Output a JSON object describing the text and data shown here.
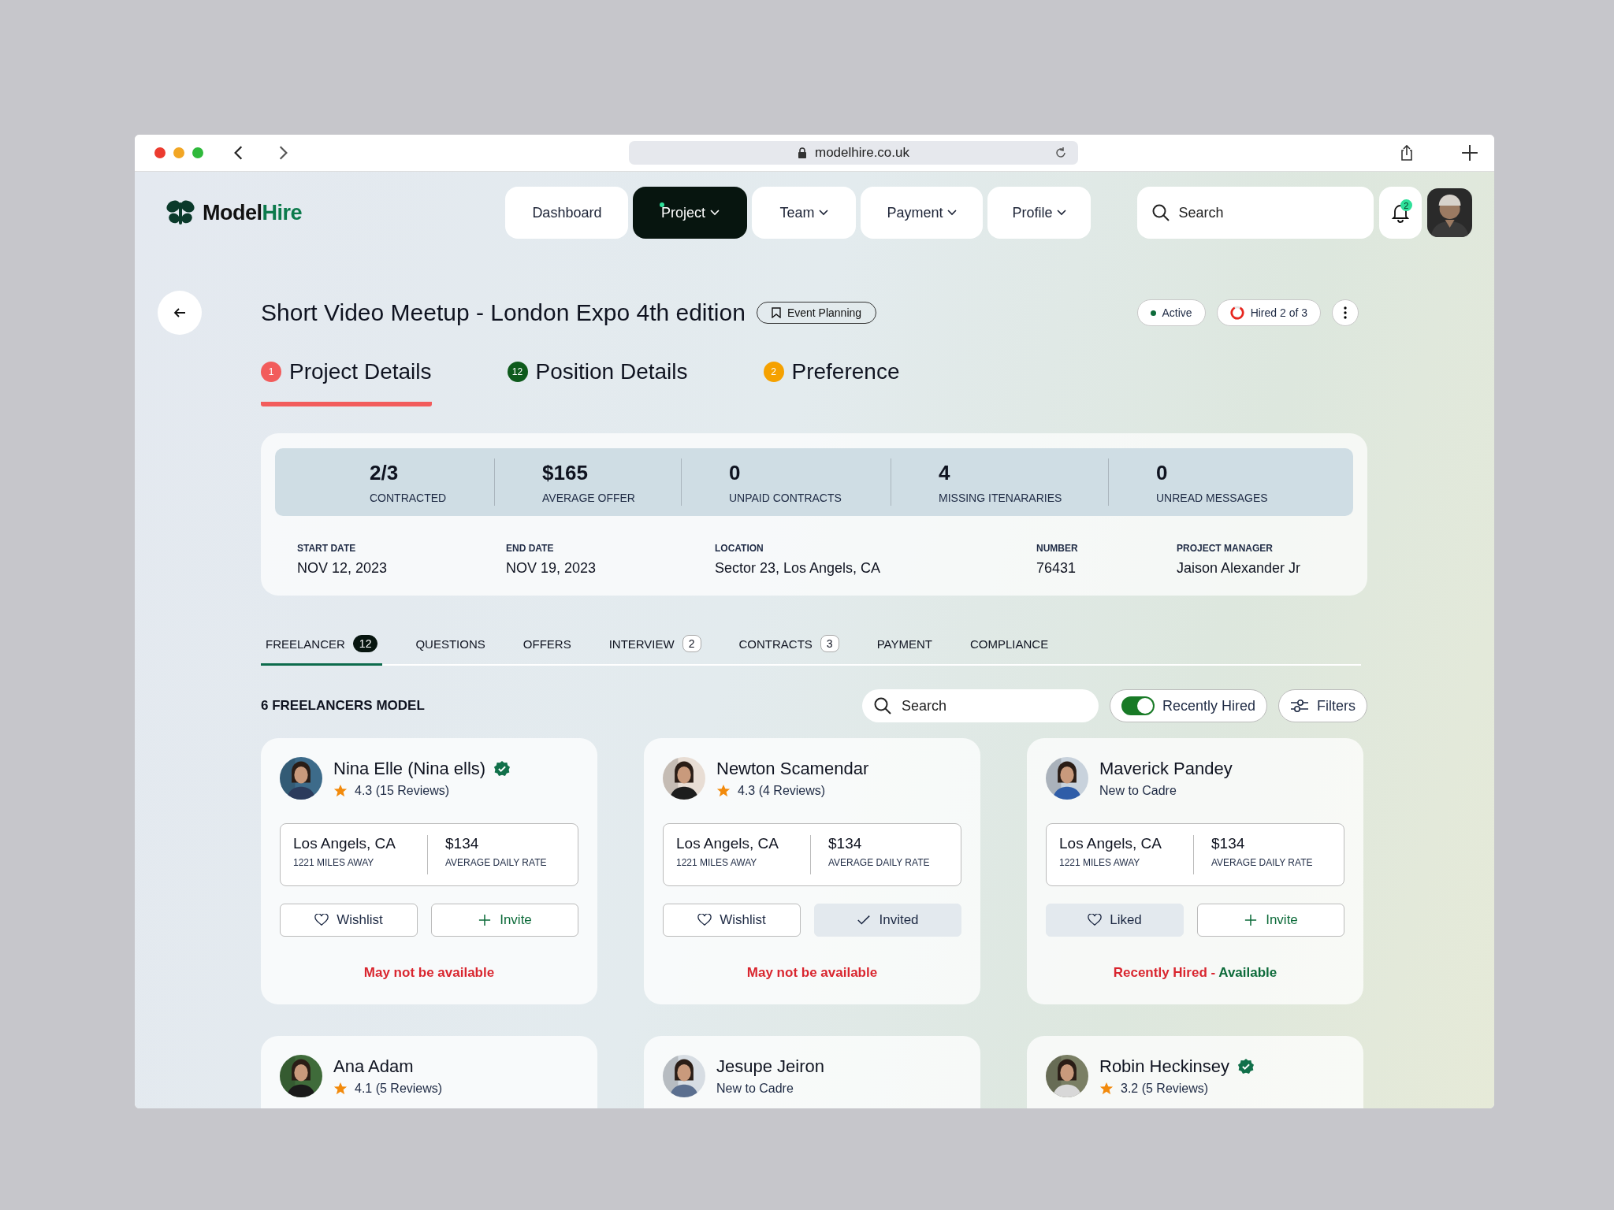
{
  "browser": {
    "url": "modelhire.co.uk"
  },
  "nav": {
    "brand": [
      "Model",
      "Hire"
    ],
    "items": [
      {
        "label": "Dashboard",
        "selected": false,
        "caret": false
      },
      {
        "label": "Project",
        "selected": true,
        "caret": true
      },
      {
        "label": "Team",
        "selected": false,
        "caret": true
      },
      {
        "label": "Payment",
        "selected": false,
        "caret": true
      },
      {
        "label": "Profile",
        "selected": false,
        "caret": true
      }
    ],
    "search": {
      "placeholder": "Search"
    },
    "notifications": "2"
  },
  "project": {
    "title": "Short Video Meetup - London Expo 4th edition",
    "tag": "Event Planning",
    "status": "Active",
    "hired": {
      "label": "Hired 2 of 3"
    }
  },
  "steps": [
    {
      "number": "1",
      "label": "Project Details",
      "color": "#f25c5c",
      "selected": true
    },
    {
      "number": "12",
      "label": "Position Details",
      "color": "#0e5a1c",
      "selected": false
    },
    {
      "number": "2",
      "label": "Preference",
      "color": "#f5a100",
      "selected": false
    }
  ],
  "stats": [
    {
      "value": "2/3",
      "label": "CONTRACTED"
    },
    {
      "value": "$165",
      "label": "AVERAGE OFFER"
    },
    {
      "value": "0",
      "label": "UNPAID CONTRACTS"
    },
    {
      "value": "4",
      "label": "MISSING ITENARARIES"
    },
    {
      "value": "0",
      "label": "UNREAD MESSAGES"
    }
  ],
  "details": [
    {
      "label": "START DATE",
      "value": "NOV 12, 2023"
    },
    {
      "label": "END DATE",
      "value": "NOV 19, 2023"
    },
    {
      "label": "LOCATION",
      "value": "Sector 23,  Los Angels, CA"
    },
    {
      "label": "NUMBER",
      "value": "76431"
    },
    {
      "label": "PROJECT MANAGER",
      "value": "Jaison Alexander Jr"
    }
  ],
  "tabs": [
    {
      "label": "FREELANCER",
      "count": "12",
      "selected": true
    },
    {
      "label": "QUESTIONS",
      "selected": false
    },
    {
      "label": "OFFERS",
      "selected": false
    },
    {
      "label": "INTERVIEW",
      "count": "2",
      "selected": false
    },
    {
      "label": "CONTRACTS",
      "count": "3",
      "selected": false
    },
    {
      "label": "PAYMENT",
      "selected": false
    },
    {
      "label": "COMPLIANCE",
      "selected": false
    }
  ],
  "list": {
    "title": "6 FREELANCERS MODEL",
    "search": {
      "placeholder": "Search"
    },
    "toggle": {
      "label": "Recently Hired",
      "on": true
    },
    "filters": "Filters"
  },
  "freelancers": [
    {
      "name": "Nina Elle (Nina ells)",
      "verified": true,
      "kind": "rated",
      "rating": "4.3 (15 Reviews)",
      "location": "Los Angels, CA",
      "distance": "1221 MILES AWAY",
      "rate": "$134",
      "rate_label": "AVERAGE DAILY RATE",
      "wishlist": {
        "label": "Wishlist",
        "selected": false
      },
      "invite": {
        "label": "Invite",
        "selected": false
      },
      "availability": [
        {
          "text": "May not be available",
          "color": "#d9262f"
        }
      ]
    },
    {
      "name": "Newton Scamendar",
      "verified": false,
      "kind": "rated",
      "rating": "4.3 (4 Reviews)",
      "location": "Los Angels, CA",
      "distance": "1221 MILES AWAY",
      "rate": "$134",
      "rate_label": "AVERAGE DAILY RATE",
      "wishlist": {
        "label": "Wishlist",
        "selected": false
      },
      "invite": {
        "label": "Invited",
        "selected": true
      },
      "availability": [
        {
          "text": "May not be available",
          "color": "#d9262f"
        }
      ]
    },
    {
      "name": "Maverick Pandey",
      "verified": false,
      "kind": "new",
      "rating": "New to Cadre",
      "location": "Los Angels, CA",
      "distance": "1221 MILES AWAY",
      "rate": "$134",
      "rate_label": "AVERAGE DAILY RATE",
      "wishlist": {
        "label": "Liked",
        "selected": true
      },
      "invite": {
        "label": "Invite",
        "selected": false
      },
      "availability": [
        {
          "text": "Recently Hired - ",
          "color": "#d9262f"
        },
        {
          "text": "Available",
          "color": "#0d6b3a"
        }
      ]
    },
    {
      "name": "Ana Adam",
      "verified": false,
      "kind": "rated",
      "rating": "4.1 (5 Reviews)"
    },
    {
      "name": "Jesupe Jeiron",
      "verified": false,
      "kind": "new",
      "rating": "New to Cadre"
    },
    {
      "name": "Robin Heckinsey",
      "verified": true,
      "kind": "rated",
      "rating": "3.2 (5 Reviews)"
    }
  ]
}
